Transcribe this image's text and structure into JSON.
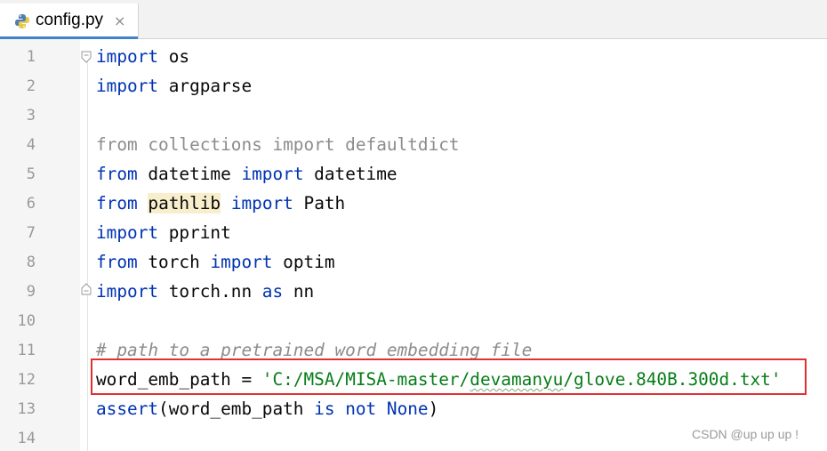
{
  "tab": {
    "label": "config.py",
    "close": "×"
  },
  "line_numbers": [
    "1",
    "2",
    "3",
    "4",
    "5",
    "6",
    "7",
    "8",
    "9",
    "10",
    "11",
    "12",
    "13",
    "14"
  ],
  "code": {
    "l1": {
      "a": "import",
      "b": " os"
    },
    "l2": {
      "a": "import",
      "b": " argparse"
    },
    "l4": {
      "a": "from collections import defaultdict"
    },
    "l5": {
      "a": "from",
      "b": " datetime ",
      "c": "import",
      "d": " datetime"
    },
    "l6": {
      "a": "from",
      "b": " ",
      "c": "pathlib",
      "d": " ",
      "e": "import",
      "f": " Path"
    },
    "l7": {
      "a": "import",
      "b": " pprint"
    },
    "l8": {
      "a": "from",
      "b": " torch ",
      "c": "import",
      "d": " optim"
    },
    "l9": {
      "a": "import",
      "b": " torch.nn ",
      "c": "as",
      "d": " nn"
    },
    "l11": {
      "a": "# path to a pretrained word embedding file"
    },
    "l12": {
      "a": "word_emb_path = ",
      "b": "'C:/MSA/MISA-master/",
      "c": "devamanyu",
      "d": "/glove.840B.300d.txt'"
    },
    "l13": {
      "a": "assert",
      "b": "(word_emb_path ",
      "c": "is not",
      "d": " ",
      "e": "None",
      "f": ")"
    }
  },
  "watermark": "CSDN @up up up !",
  "colors": {
    "keyword": "#0033b3",
    "string": "#067d17",
    "comment": "#8c8c8c",
    "highlight_box": "#e03030"
  }
}
